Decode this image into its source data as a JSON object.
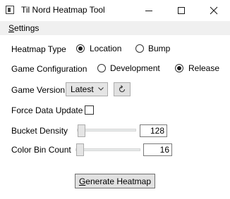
{
  "window": {
    "title": "Til Nord Heatmap Tool"
  },
  "menu": {
    "settings_first": "S",
    "settings_rest": "ettings"
  },
  "heatmap_type": {
    "label": "Heatmap Type",
    "options": [
      "Location",
      "Bump"
    ],
    "selected": "Location"
  },
  "game_configuration": {
    "label": "Game Configuration",
    "options": [
      "Development",
      "Release"
    ],
    "selected": "Release"
  },
  "game_version": {
    "label": "Game Version",
    "selected": "Latest"
  },
  "force_update": {
    "label": "Force Data Update",
    "checked": false
  },
  "bucket_density": {
    "label": "Bucket Density",
    "value": "128"
  },
  "color_bin_count": {
    "label": "Color Bin Count",
    "value": "16"
  },
  "generate": {
    "label_first": "G",
    "label_rest": "enerate Heatmap"
  },
  "colors": {
    "menubar": "#f0f0f0",
    "button": "#e1e1e1"
  },
  "icons": {
    "minimize": "minimize-icon",
    "maximize": "maximize-icon",
    "close": "close-icon",
    "refresh": "refresh-icon",
    "dropdown": "chevron-down-icon"
  }
}
